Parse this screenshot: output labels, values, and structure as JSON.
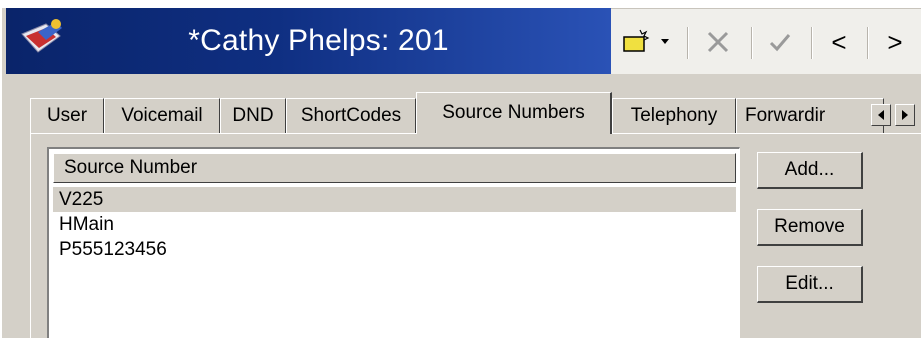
{
  "window": {
    "title": "*Cathy Phelps: 201"
  },
  "toolbar": {
    "new_icon": "new-item-icon",
    "dropdown_icon": "dropdown-arrow-icon",
    "delete_icon": "close-x-icon",
    "ok_icon": "checkmark-icon",
    "prev_label": "<",
    "next_label": ">"
  },
  "tabs": [
    {
      "label": "User"
    },
    {
      "label": "Voicemail"
    },
    {
      "label": "DND"
    },
    {
      "label": "ShortCodes"
    },
    {
      "label": "Source Numbers",
      "active": true
    },
    {
      "label": "Telephony"
    },
    {
      "label": "Forwardir"
    }
  ],
  "source_numbers": {
    "column_header": "Source Number",
    "rows": [
      "V225",
      "HMain",
      "P555123456"
    ],
    "selected_index": 0
  },
  "buttons": {
    "add": "Add...",
    "remove": "Remove",
    "edit": "Edit..."
  },
  "colors": {
    "title_bar": "#0a246a",
    "face": "#d4d0c8",
    "selected_row": "#d4d0c8"
  }
}
